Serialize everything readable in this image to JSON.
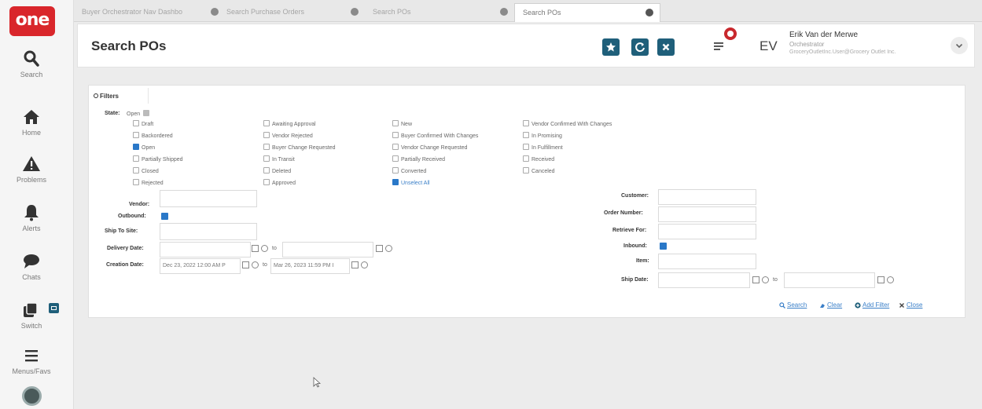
{
  "brand": {
    "logo_text": "one"
  },
  "sidebar": {
    "items": [
      {
        "label": "Search",
        "icon": "magnifier-icon"
      },
      {
        "label": "Home",
        "icon": "home-icon"
      },
      {
        "label": "Problems",
        "icon": "warning-icon"
      },
      {
        "label": "Alerts",
        "icon": "bell-icon"
      },
      {
        "label": "Chats",
        "icon": "chat-bubble-icon"
      },
      {
        "label": "Switch",
        "icon": "switch-icon"
      },
      {
        "label": "Menus/Favs",
        "icon": "hamburger-icon"
      }
    ]
  },
  "tabs": [
    {
      "label": "Buyer Orchestrator Nav Dashbo"
    },
    {
      "label": "Search Purchase Orders"
    },
    {
      "label": "Search POs"
    },
    {
      "label": "Search POs"
    }
  ],
  "header": {
    "title": "Search POs",
    "user": {
      "initials": "EV",
      "name": "Erik Van der Merwe",
      "role": "Orchestrator",
      "email": "GroceryOutletInc.User@Grocery Outlet Inc."
    }
  },
  "filters": {
    "tab_label": "Filters",
    "state": {
      "label": "State:",
      "selected_value": "Open",
      "options": [
        [
          "Draft",
          "Awaiting Approval",
          "New",
          "Vendor Confirmed With Changes"
        ],
        [
          "Backordered",
          "Vendor Rejected",
          "Buyer Confirmed With Changes",
          "In Promising"
        ],
        [
          "Open",
          "Buyer Change Requested",
          "Vendor Change Requested",
          "In Fulfillment"
        ],
        [
          "Partially Shipped",
          "In Transit",
          "Partially Received",
          "Received"
        ],
        [
          "Closed",
          "Deleted",
          "Converted",
          "Canceled"
        ],
        [
          "Rejected",
          "Approved",
          "Unselect All",
          ""
        ]
      ]
    },
    "left": {
      "vendor_label": "Vendor:",
      "outbound_label": "Outbound:",
      "ship_to_site_label": "Ship To Site:",
      "delivery_date_label": "Delivery Date:",
      "creation_date_label": "Creation Date:",
      "creation_from": "Dec 23, 2022 12:00 AM P",
      "creation_to": "Mar 26, 2023 11:59 PM I",
      "to_text": "to"
    },
    "right": {
      "customer_label": "Customer:",
      "order_number_label": "Order Number:",
      "retrieve_for_label": "Retrieve For:",
      "inbound_label": "Inbound:",
      "item_label": "Item:",
      "ship_date_label": "Ship Date:",
      "to_text": "to"
    },
    "actions": {
      "search": "Search",
      "clear": "Clear",
      "add_filter": "Add Filter",
      "close": "Close"
    }
  },
  "colors": {
    "brand_red": "#d9262b",
    "header_button": "#1f5f7a",
    "checkbox_blue": "#2a78c8",
    "link_blue": "#3a7fc8"
  }
}
